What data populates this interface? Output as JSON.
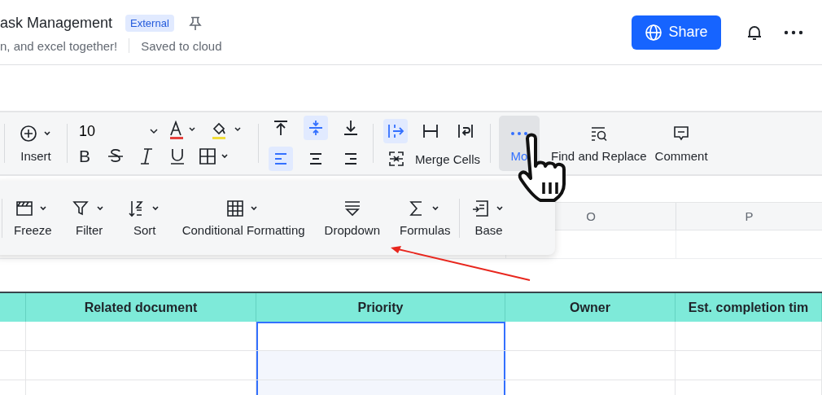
{
  "doc": {
    "title": "ask Management",
    "badge": "External",
    "subtitle": "n, and excel together!",
    "save_status": "Saved to cloud"
  },
  "header_actions": {
    "share": "Share"
  },
  "toolbar": {
    "insert": "Insert",
    "font_size": "10",
    "bold_glyph": "B",
    "align_buttons": [
      {
        "selected": false
      },
      {
        "selected": true
      },
      {
        "selected": false
      },
      {
        "selected": true
      },
      {
        "selected": false
      },
      {
        "selected": false
      }
    ],
    "wrap_buttons": [
      {
        "selected": true
      },
      {
        "selected": false
      },
      {
        "selected": false
      }
    ],
    "merge": "Merge Cells",
    "more": {
      "label": "Mo",
      "selected": true
    },
    "find": "Find and Replace",
    "comment": "Comment"
  },
  "more_menu": [
    {
      "label": "Freeze"
    },
    {
      "label": "Filter"
    },
    {
      "label": "Sort"
    },
    {
      "label": "Conditional Formatting"
    },
    {
      "label": "Dropdown"
    },
    {
      "label": "Formulas"
    },
    {
      "label": "Base"
    }
  ],
  "column_letters": [
    "O",
    "P"
  ],
  "table": {
    "columns": [
      {
        "selected": false
      },
      {
        "label": "Related document",
        "selected": false
      },
      {
        "label": "Priority",
        "selected": true
      },
      {
        "label": "Owner",
        "selected": false
      },
      {
        "label": "Est. completion tim",
        "selected": false
      }
    ]
  }
}
